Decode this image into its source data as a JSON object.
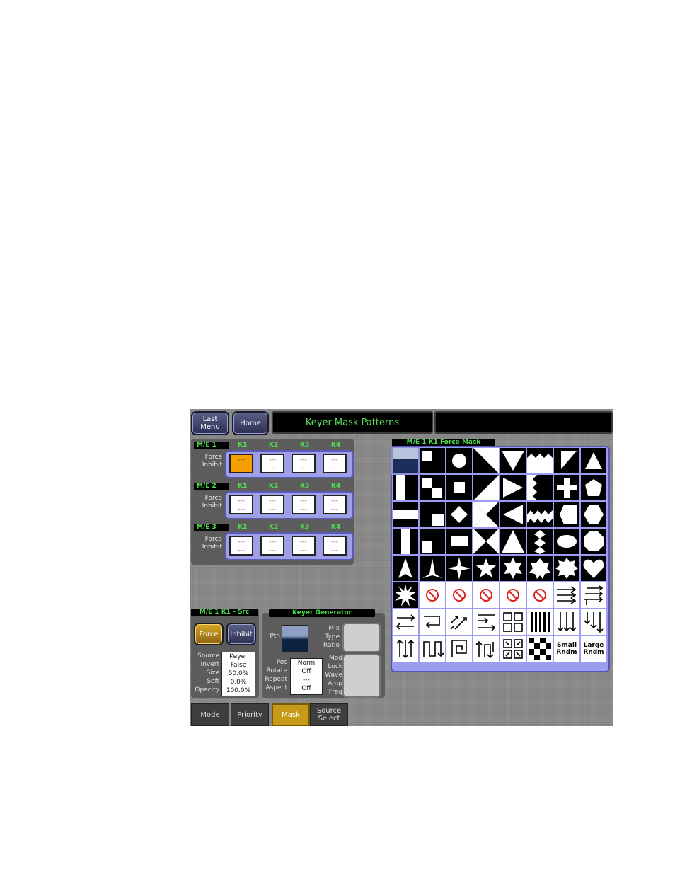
{
  "header": {
    "last_menu": "Last\nMenu",
    "home": "Home",
    "title": "Keyer Mask Patterns",
    "title2": ""
  },
  "me_rows": [
    {
      "label": "M/E 1",
      "force": "Force",
      "inhibit": "Inhibit",
      "keys": [
        {
          "name": "K1",
          "f": "---",
          "i": "---"
        },
        {
          "name": "K2",
          "f": "---",
          "i": "---"
        },
        {
          "name": "K3",
          "f": "---",
          "i": "---"
        },
        {
          "name": "K4",
          "f": "---",
          "i": "---"
        }
      ]
    },
    {
      "label": "M/E 2",
      "force": "Force",
      "inhibit": "Inhibit",
      "keys": [
        {
          "name": "K1",
          "f": "---",
          "i": "---"
        },
        {
          "name": "K2",
          "f": "---",
          "i": "---"
        },
        {
          "name": "K3",
          "f": "---",
          "i": "---"
        },
        {
          "name": "K4",
          "f": "---",
          "i": "---"
        }
      ]
    },
    {
      "label": "M/E 3",
      "force": "Force",
      "inhibit": "Inhibit",
      "keys": [
        {
          "name": "K1",
          "f": "---",
          "i": "---"
        },
        {
          "name": "K2",
          "f": "---",
          "i": "---"
        },
        {
          "name": "K3",
          "f": "---",
          "i": "---"
        },
        {
          "name": "K4",
          "f": "---",
          "i": "---"
        }
      ]
    }
  ],
  "force_mask": {
    "title": "M/E 1 K1 Force Mask",
    "small_random": "Small\nRndm",
    "large_random": "Large\nRndm"
  },
  "src_panel": {
    "title": "M/E 1 K1 - Src",
    "force": "Force",
    "inhibit": "Inhibit",
    "labels": [
      "Source",
      "Invert",
      "Size",
      "Soft",
      "Opacity"
    ],
    "values": [
      "Keyer",
      "False",
      "50.0%",
      "0.0%",
      "100.0%"
    ]
  },
  "keyer_gen": {
    "title": "Keyer Generator",
    "ptn": "Ptn",
    "mix_labels": [
      "Mix",
      "Type",
      "Ratio"
    ],
    "pos_labels": [
      "Pos",
      "Rotate",
      "Repeat",
      "Aspect"
    ],
    "pos_values": [
      "Norm",
      "Off",
      "---",
      "Off"
    ],
    "mod_labels": [
      "Mod",
      "Lock",
      "Wave",
      "Amp",
      "Freq"
    ]
  },
  "tabs": [
    {
      "label": "Mode"
    },
    {
      "label": "Priority"
    },
    {
      "label": "Mask"
    },
    {
      "label": "Source\nSelect"
    }
  ],
  "colors": {
    "accent_green": "#4ee04e",
    "selected_orange": "#f5a000",
    "tab_selected": "#c79b1a",
    "grid_frame": "#9c9cf0"
  }
}
